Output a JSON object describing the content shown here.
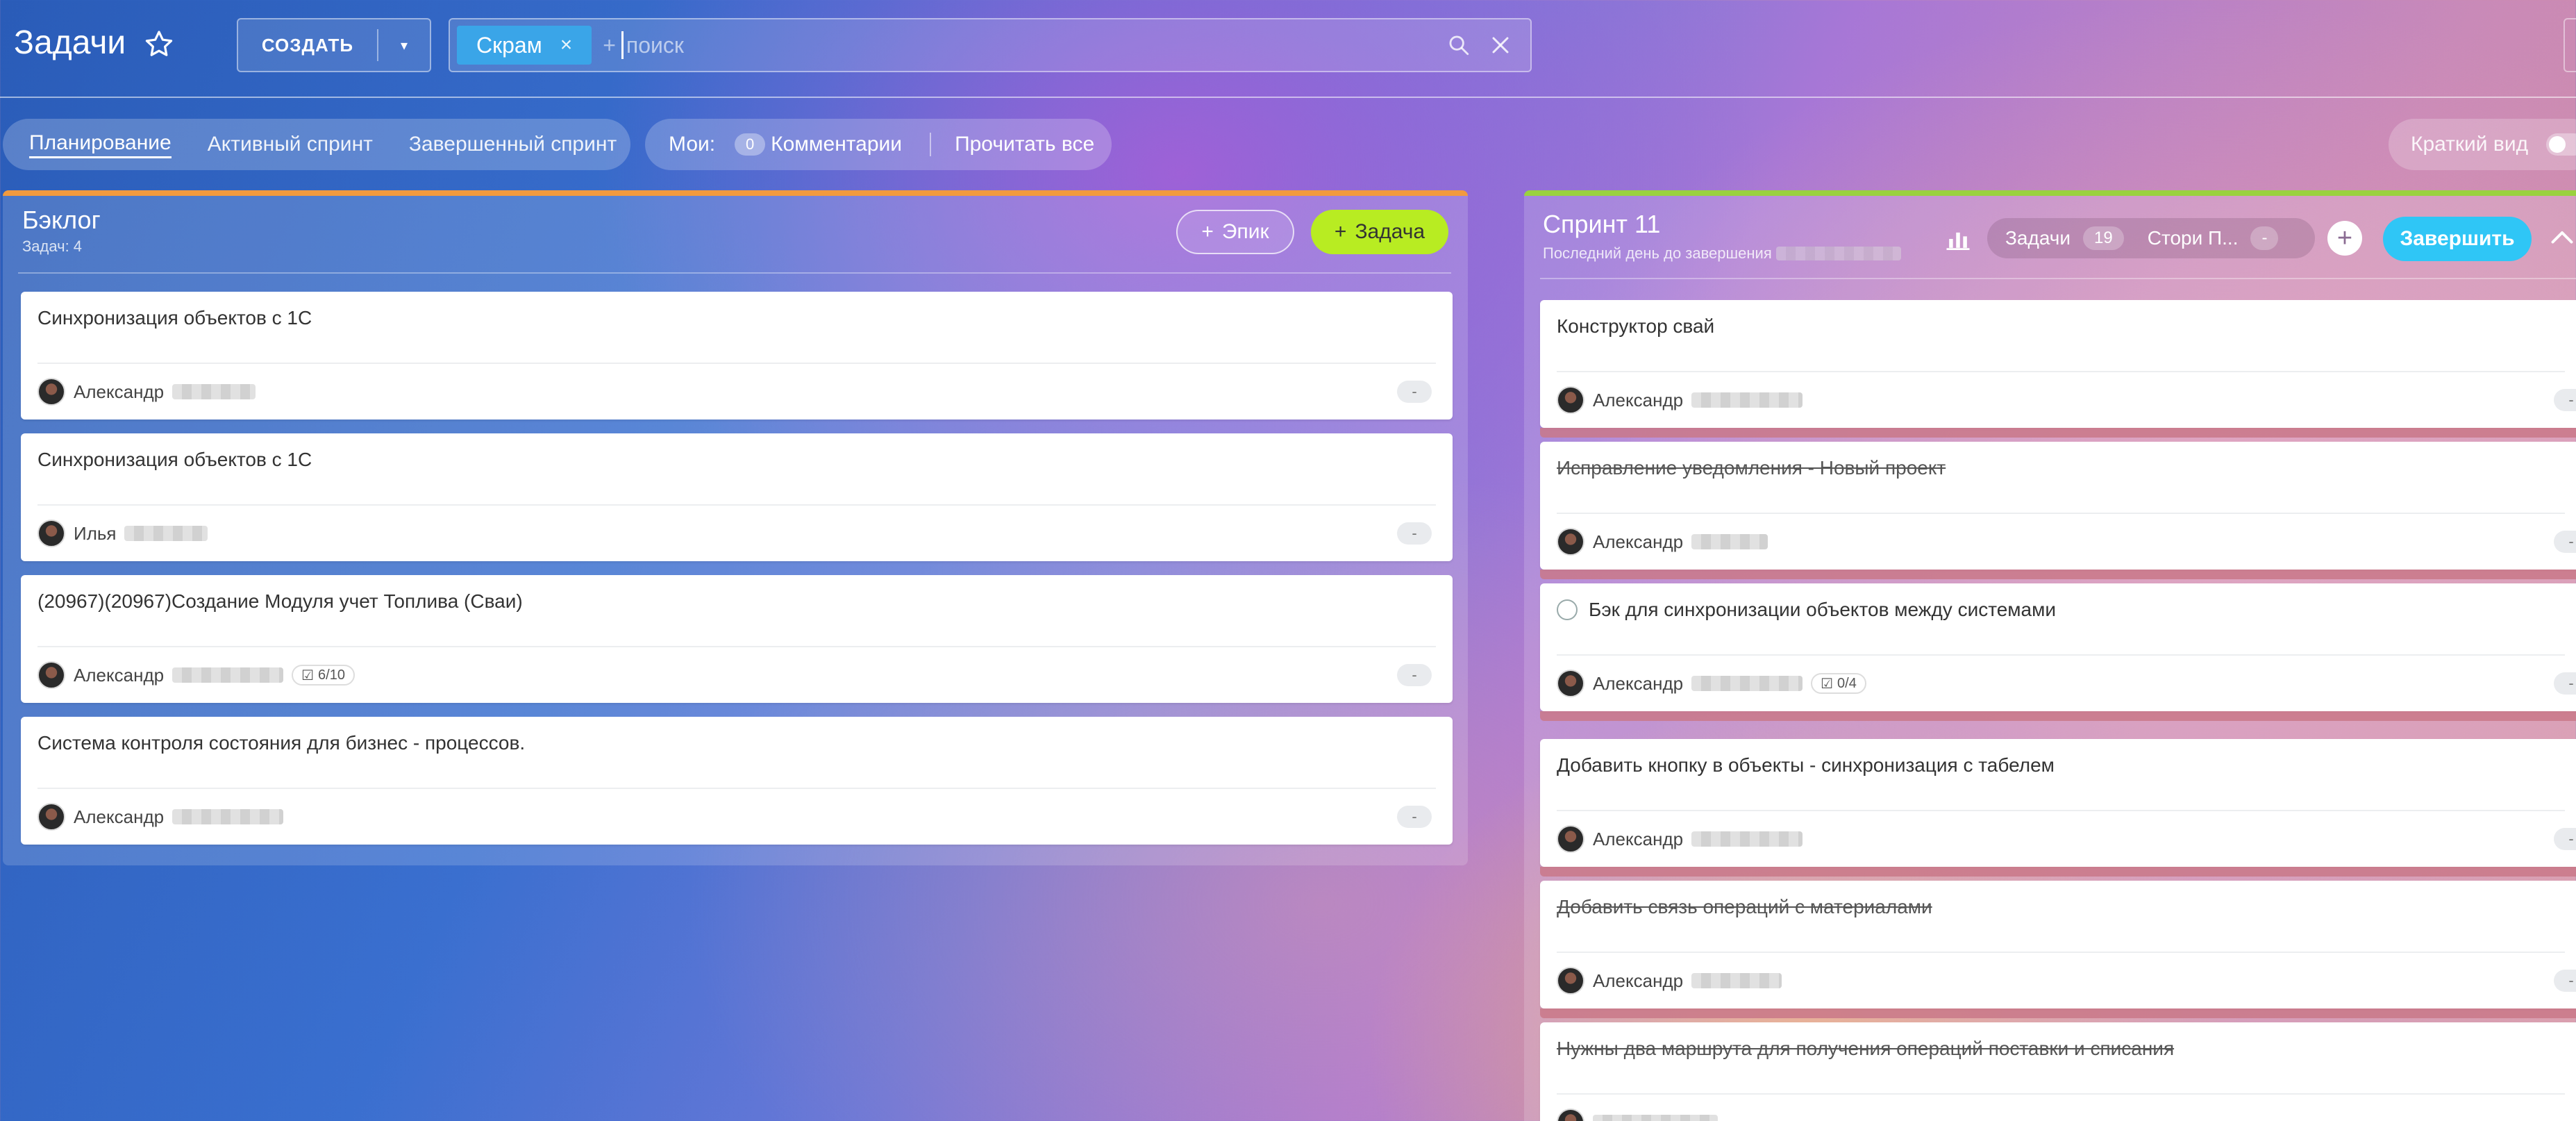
{
  "header": {
    "title": "Задачи",
    "create_label": "СОЗДАТЬ",
    "search": {
      "chip": "Скрам",
      "plus": "+",
      "placeholder": "поиск"
    }
  },
  "tabs": [
    {
      "label": "Планирование",
      "active": true
    },
    {
      "label": "Активный спринт",
      "active": false
    },
    {
      "label": "Завершенный спринт",
      "active": false
    }
  ],
  "my": {
    "label": "Мои:",
    "count": "0",
    "comments": "Комментарии",
    "read_all": "Прочитать все"
  },
  "compact_view": {
    "label": "Краткий вид",
    "on": false
  },
  "backlog": {
    "title": "Бэклог",
    "subtitle": "Задач: 4",
    "epic_label": "Эпик",
    "task_label": "Задача",
    "cards": [
      {
        "title": "Синхронизация объектов с 1С",
        "assignee": "Александр",
        "checklist": null,
        "points": "-"
      },
      {
        "title": "Синхронизация объектов с 1С",
        "assignee": "Илья",
        "checklist": null,
        "points": "-"
      },
      {
        "title": "(20967)(20967)Создание Модуля учет Топлива (Сваи)",
        "assignee": "Александр",
        "checklist": "6/10",
        "points": "-"
      },
      {
        "title": "Система контроля состояния для бизнес - процессов.",
        "assignee": "Александр",
        "checklist": null,
        "points": "-"
      }
    ]
  },
  "sprint": {
    "title": "Спринт 11",
    "subtitle": "Последний день до завершения",
    "tasks_label": "Задачи",
    "tasks_count": "19",
    "story_label": "Стори П...",
    "story_value": "-",
    "finish_label": "Завершить",
    "cards": [
      {
        "title": "Конструктор свай",
        "done": false,
        "assignee": "Александр",
        "checklist": null,
        "points": "-"
      },
      {
        "title": "Исправление уведомления - Новый проект",
        "done": true,
        "assignee": "Александр",
        "checklist": null,
        "points": "-"
      },
      {
        "title": "Бэк для синхронизации объектов между системами",
        "done": false,
        "assignee": "Александр",
        "checklist": "0/4",
        "points": "-"
      },
      {
        "title": "Добавить кнопку в объекты - синхронизация с табелем",
        "done": false,
        "assignee": "Александр",
        "checklist": null,
        "points": "-"
      },
      {
        "title": "Добавить связь операций с материалами",
        "done": true,
        "assignee": "Александр",
        "checklist": null,
        "points": "-"
      },
      {
        "title": "Нужны два маршрута для получения операций поставки и списания",
        "done": true,
        "assignee": "",
        "checklist": null,
        "points": ""
      }
    ]
  },
  "colors": {
    "backlog_accent": "#f29a3e",
    "sprint_accent": "#9ad13f",
    "chip": "#3aa5e8",
    "task_button": "#b8ec22",
    "finish_button": "#2fc6f6"
  }
}
